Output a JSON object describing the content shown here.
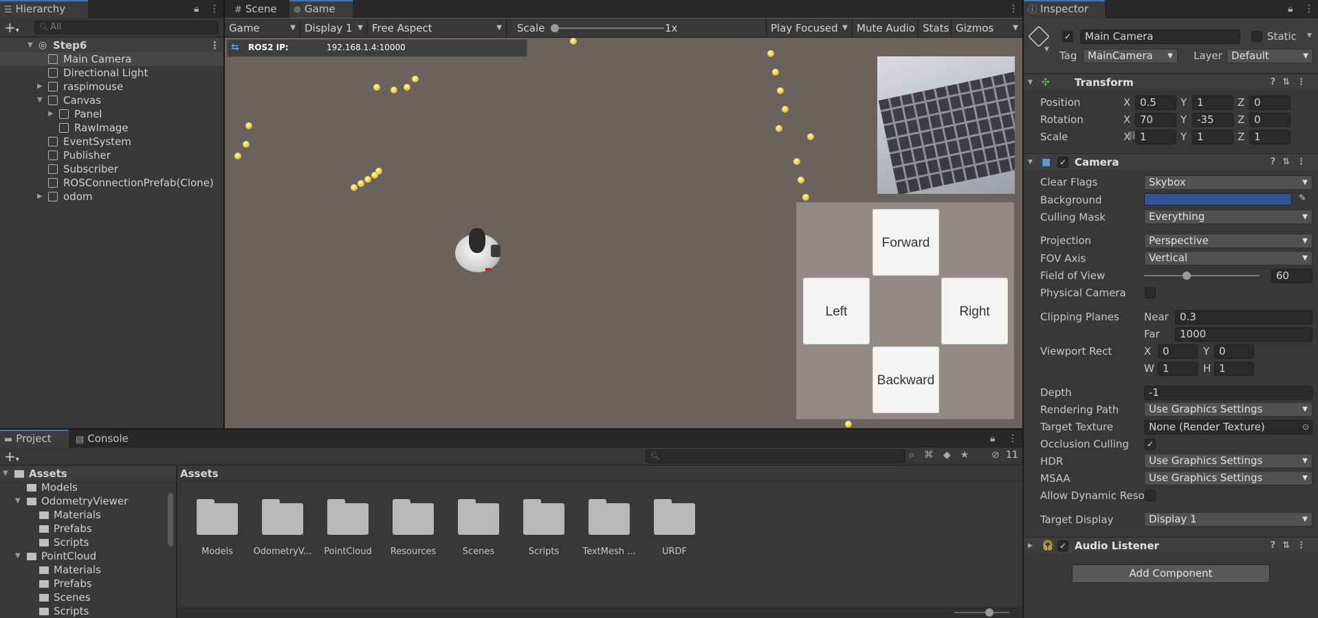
{
  "hierarchy": {
    "tab": "Hierarchy",
    "search_placeholder": "All",
    "scene": "Step6",
    "items": [
      {
        "label": "Main Camera",
        "depth": 1,
        "expand": "",
        "selected": true
      },
      {
        "label": "Directional Light",
        "depth": 1,
        "expand": ""
      },
      {
        "label": "raspimouse",
        "depth": 1,
        "expand": "▶"
      },
      {
        "label": "Canvas",
        "depth": 1,
        "expand": "▼"
      },
      {
        "label": "Panel",
        "depth": 2,
        "expand": "▶"
      },
      {
        "label": "RawImage",
        "depth": 2,
        "expand": ""
      },
      {
        "label": "EventSystem",
        "depth": 1,
        "expand": ""
      },
      {
        "label": "Publisher",
        "depth": 1,
        "expand": ""
      },
      {
        "label": "Subscriber",
        "depth": 1,
        "expand": ""
      },
      {
        "label": "ROSConnectionPrefab(Clone)",
        "depth": 1,
        "expand": ""
      },
      {
        "label": "odom",
        "depth": 1,
        "expand": "▶"
      }
    ]
  },
  "view": {
    "tabs": [
      "Scene",
      "Game"
    ],
    "active_tab": "Game",
    "mode": "Game",
    "display": "Display 1",
    "aspect": "Free Aspect",
    "scale_label": "Scale",
    "scale_value": "1x",
    "play_mode": "Play Focused",
    "mute": "Mute Audio",
    "stats": "Stats",
    "gizmos": "Gizmos",
    "ros_label": "ROS2 IP:",
    "ros_ip": "192.168.1.4:10000",
    "buttons": {
      "forward": "Forward",
      "left": "Left",
      "right": "Right",
      "backward": "Backward"
    },
    "ground_color": "#6b615d"
  },
  "inspector": {
    "tab": "Inspector",
    "object_name": "Main Camera",
    "static_label": "Static",
    "tag_label": "Tag",
    "tag": "MainCamera",
    "layer_label": "Layer",
    "layer": "Default",
    "transform": {
      "title": "Transform",
      "position_label": "Position",
      "position": [
        "0.5",
        "1",
        "0"
      ],
      "rotation_label": "Rotation",
      "rotation": [
        "70",
        "-35",
        "0"
      ],
      "scale_label": "Scale",
      "scale": [
        "1",
        "1",
        "1"
      ]
    },
    "camera": {
      "title": "Camera",
      "clear_flags_label": "Clear Flags",
      "clear_flags": "Skybox",
      "background_label": "Background",
      "background_color": "#2f5597",
      "culling_mask_label": "Culling Mask",
      "culling_mask": "Everything",
      "projection_label": "Projection",
      "projection": "Perspective",
      "fov_axis_label": "FOV Axis",
      "fov_axis": "Vertical",
      "fov_label": "Field of View",
      "fov": "60",
      "physical_label": "Physical Camera",
      "clipping_label": "Clipping Planes",
      "near_label": "Near",
      "near": "0.3",
      "far_label": "Far",
      "far": "1000",
      "viewport_label": "Viewport Rect",
      "vx": "0",
      "vy": "0",
      "vw": "1",
      "vh": "1",
      "depth_label": "Depth",
      "depth": "-1",
      "rendering_label": "Rendering Path",
      "rendering": "Use Graphics Settings",
      "target_texture_label": "Target Texture",
      "target_texture": "None (Render Texture)",
      "occlusion_label": "Occlusion Culling",
      "hdr_label": "HDR",
      "hdr": "Use Graphics Settings",
      "msaa_label": "MSAA",
      "msaa": "Use Graphics Settings",
      "dynres_label": "Allow Dynamic Reso",
      "target_display_label": "Target Display",
      "target_display": "Display 1"
    },
    "audio_listener": "Audio Listener",
    "add_component": "Add Component"
  },
  "project": {
    "tabs": [
      "Project",
      "Console"
    ],
    "hidden_count": "11",
    "breadcrumb": "Assets",
    "tree": [
      {
        "label": "Assets",
        "depth": 0,
        "expand": "▼",
        "bold": true
      },
      {
        "label": "Models",
        "depth": 1,
        "expand": ""
      },
      {
        "label": "OdometryViewer",
        "depth": 1,
        "expand": "▼"
      },
      {
        "label": "Materials",
        "depth": 2,
        "expand": ""
      },
      {
        "label": "Prefabs",
        "depth": 2,
        "expand": ""
      },
      {
        "label": "Scripts",
        "depth": 2,
        "expand": ""
      },
      {
        "label": "PointCloud",
        "depth": 1,
        "expand": "▼"
      },
      {
        "label": "Materials",
        "depth": 2,
        "expand": ""
      },
      {
        "label": "Prefabs",
        "depth": 2,
        "expand": ""
      },
      {
        "label": "Scenes",
        "depth": 2,
        "expand": ""
      },
      {
        "label": "Scripts",
        "depth": 2,
        "expand": ""
      }
    ],
    "folders": [
      "Models",
      "OdometryV...",
      "PointCloud",
      "Resources",
      "Scenes",
      "Scripts",
      "TextMesh ...",
      "URDF"
    ]
  }
}
